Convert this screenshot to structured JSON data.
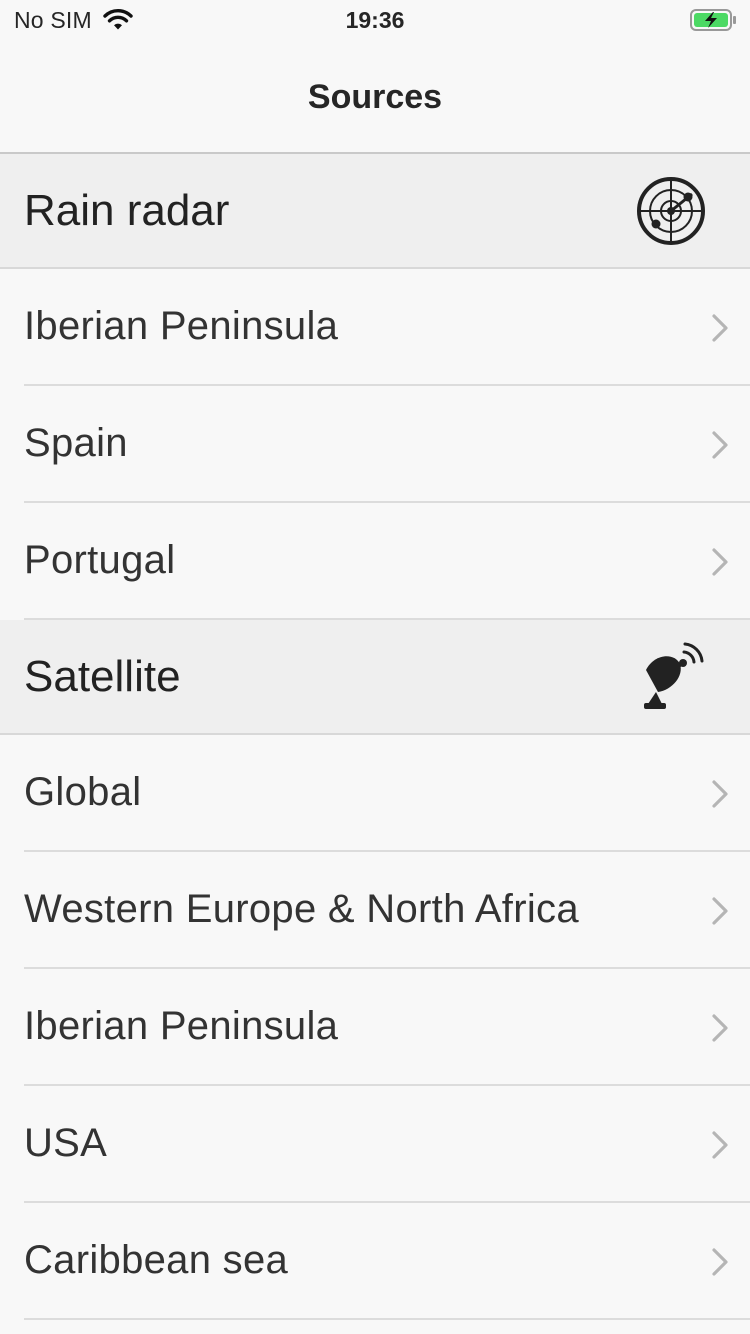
{
  "status_bar": {
    "carrier": "No SIM",
    "time": "19:36",
    "icons": [
      "wifi-icon",
      "battery-charging-icon"
    ],
    "battery_color": "#4cd964"
  },
  "nav": {
    "title": "Sources"
  },
  "sections": [
    {
      "title": "Rain radar",
      "icon": "radar-icon",
      "items": [
        {
          "label": "Iberian Peninsula"
        },
        {
          "label": "Spain"
        },
        {
          "label": "Portugal"
        }
      ]
    },
    {
      "title": "Satellite",
      "icon": "satellite-dish-icon",
      "items": [
        {
          "label": "Global"
        },
        {
          "label": "Western Europe & North Africa"
        },
        {
          "label": "Iberian Peninsula"
        },
        {
          "label": "USA"
        },
        {
          "label": "Caribbean sea"
        }
      ]
    }
  ],
  "row_accessory": "chevron-right-icon"
}
